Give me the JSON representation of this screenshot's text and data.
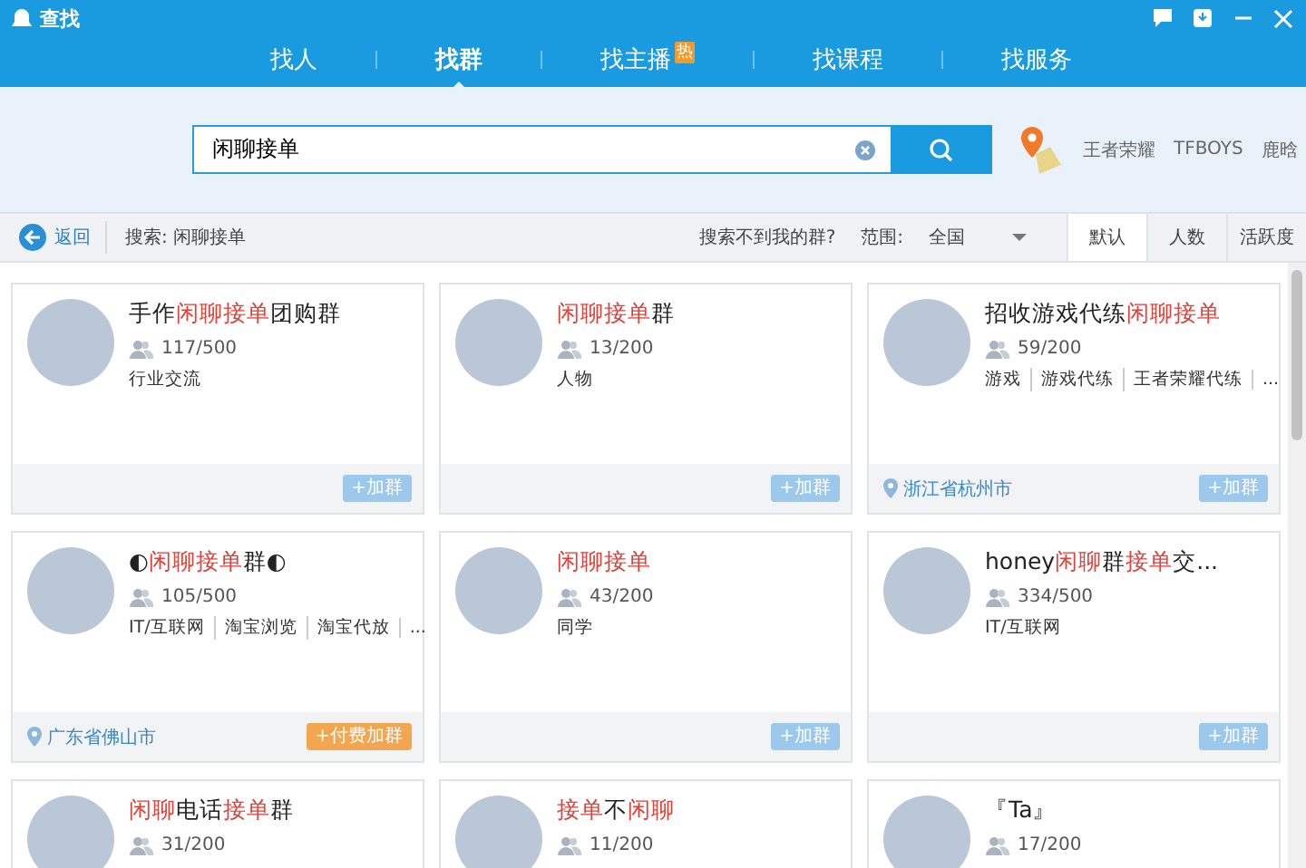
{
  "window": {
    "title": "查找"
  },
  "tabs": [
    {
      "label": "找人",
      "selected": false
    },
    {
      "label": "找群",
      "selected": true
    },
    {
      "label": "找主播",
      "selected": false,
      "badge": "热"
    },
    {
      "label": "找课程",
      "selected": false
    },
    {
      "label": "找服务",
      "selected": false
    }
  ],
  "search": {
    "value": "闲聊接单"
  },
  "hot_keywords": [
    "王者荣耀",
    "TFBOYS",
    "鹿晗"
  ],
  "toolbar": {
    "back": "返回",
    "query": "搜索: 闲聊接单",
    "cant_find": "搜索不到我的群?",
    "range_label": "范围:",
    "range_value": "全国",
    "sort_tabs": [
      {
        "label": "默认",
        "selected": true
      },
      {
        "label": "人数",
        "selected": false
      },
      {
        "label": "活跃度",
        "selected": false
      }
    ]
  },
  "groups": [
    {
      "title": [
        {
          "text": "手作",
          "highlight": false
        },
        {
          "text": "闲聊接单",
          "highlight": true
        },
        {
          "text": "团购群",
          "highlight": false
        }
      ],
      "members": "117/500",
      "tags": [
        "行业交流"
      ],
      "join": {
        "label": "+加群",
        "kind": "free"
      }
    },
    {
      "title": [
        {
          "text": "闲聊接单",
          "highlight": true
        },
        {
          "text": "群",
          "highlight": false
        }
      ],
      "members": "13/200",
      "tags": [
        "人物"
      ],
      "join": {
        "label": "+加群",
        "kind": "free"
      }
    },
    {
      "title": [
        {
          "text": "招收游戏代练",
          "highlight": false
        },
        {
          "text": "闲聊接单",
          "highlight": true
        }
      ],
      "members": "59/200",
      "tags": [
        "游戏",
        "游戏代练",
        "王者荣耀代练",
        "..."
      ],
      "location": "浙江省杭州市",
      "join": {
        "label": "+加群",
        "kind": "free"
      }
    },
    {
      "title": [
        {
          "text": "◐",
          "highlight": false
        },
        {
          "text": "闲聊接单",
          "highlight": true
        },
        {
          "text": "群◐",
          "highlight": false
        }
      ],
      "members": "105/500",
      "tags": [
        "IT/互联网",
        "淘宝浏览",
        "淘宝代放",
        "..."
      ],
      "location": "广东省佛山市",
      "join": {
        "label": "+付费加群",
        "kind": "paid"
      }
    },
    {
      "title": [
        {
          "text": "闲聊接单",
          "highlight": true
        }
      ],
      "members": "43/200",
      "tags": [
        "同学"
      ],
      "join": {
        "label": "+加群",
        "kind": "free"
      }
    },
    {
      "title": [
        {
          "text": "honey",
          "highlight": false
        },
        {
          "text": "闲聊",
          "highlight": true
        },
        {
          "text": "群",
          "highlight": false
        },
        {
          "text": "接单",
          "highlight": true
        },
        {
          "text": "交...",
          "highlight": false
        }
      ],
      "members": "334/500",
      "tags": [
        "IT/互联网"
      ],
      "join": {
        "label": "+加群",
        "kind": "free"
      }
    },
    {
      "title": [
        {
          "text": "闲聊",
          "highlight": true
        },
        {
          "text": "电话",
          "highlight": false
        },
        {
          "text": "接单",
          "highlight": true
        },
        {
          "text": "群",
          "highlight": false
        }
      ],
      "members": "31/200"
    },
    {
      "title": [
        {
          "text": "接单",
          "highlight": true
        },
        {
          "text": "不",
          "highlight": false
        },
        {
          "text": "闲聊",
          "highlight": true
        }
      ],
      "members": "11/200"
    },
    {
      "title": [
        {
          "text": "『Ta』",
          "highlight": false
        }
      ],
      "members": "17/200"
    }
  ]
}
